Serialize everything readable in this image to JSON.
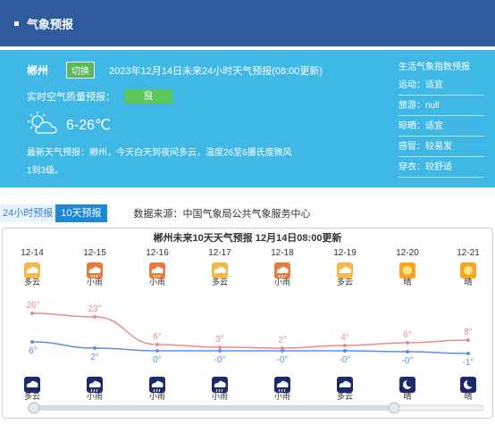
{
  "header": {
    "title": "气象预报"
  },
  "current": {
    "city": "郴州",
    "switch_label": "切换",
    "forecast_title": "2023年12月14日未来24小时天气预报(08:00更新)",
    "air_quality_label": "实时空气质量预报：",
    "air_quality_value": "良",
    "temp_range": "6-26℃",
    "weather_icon": "partly-cloudy-day-icon",
    "description": "最新天气预报：郴州，今天白天到夜间多云，温度26至6摄氏度微风1到3级。"
  },
  "life_index": {
    "title": "生活气象指数预报",
    "items": [
      "运动：适宜",
      "旅游：null",
      "晾晒：适宜",
      "感冒：较易发",
      "穿衣：较舒适"
    ]
  },
  "tabs": {
    "tab_24h": "24小时预报",
    "tab_10d": "10天预报"
  },
  "source": "数据来源：中国气象局公共气象服务中心",
  "chart_data": {
    "type": "line",
    "title": "郴州未来10天天气预报  12月14日08:00更新",
    "categories": [
      "12-14",
      "12-15",
      "12-16",
      "12-17",
      "12-18",
      "12-19",
      "12-20",
      "12-21"
    ],
    "day_weather": [
      "多云",
      "小雨",
      "小雨",
      "多云",
      "小雨",
      "多云",
      "晴",
      "晴"
    ],
    "night_weather": [
      "多云",
      "小雨",
      "小雨",
      "小雨",
      "小雨",
      "多云",
      "晴",
      "晴"
    ],
    "series": [
      {
        "name": "high",
        "values": [
          26,
          23,
          6,
          3,
          2,
          4,
          6,
          8
        ],
        "color": "#f08a8a"
      },
      {
        "name": "low",
        "values": [
          6,
          2,
          0,
          0,
          0,
          0,
          0,
          -1
        ],
        "labels": [
          "6°",
          "2°",
          "0°",
          "-0°",
          "-0°",
          "-0°",
          "-0°",
          "-1°"
        ],
        "color": "#5b8ff0"
      }
    ]
  },
  "colors": {
    "header": "#2d5b9e",
    "panel": "#3fb8e6",
    "air_good": "#5cc85c",
    "tab_active": "#1e88d8"
  }
}
